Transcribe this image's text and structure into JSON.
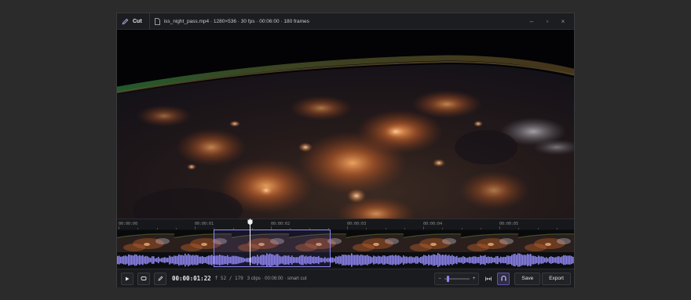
{
  "titlebar": {
    "app_name": "Cut",
    "file_info": "iss_night_pass.mp4 · 1280×536 · 30 fps · 00:06:00 · 180 frames",
    "minimize": "–",
    "maximize": "▫",
    "close": "×"
  },
  "timeline": {
    "ruler_labels": [
      "00:00:00",
      "00:00:01",
      "00:00:02",
      "00:00:03",
      "00:00:04",
      "00:00:05"
    ],
    "playhead_fraction": 0.29,
    "selection": {
      "start_fraction": 0.212,
      "end_fraction": 0.464
    },
    "waveform_color": "#8f86f0"
  },
  "controls": {
    "timecode": "00:00:01:22",
    "frame": "f 52 / 179",
    "status": "3 clips · 00:06:00 · smart cut",
    "zoom_minus": "−",
    "zoom_plus": "+",
    "zoom_level_fraction": 0.1,
    "save_label": "Save",
    "export_label": "Export"
  },
  "colors": {
    "accent": "#8f86f0",
    "background": "#2b2b2b",
    "window": "#111214"
  },
  "icons": {
    "app": "pen-icon",
    "file": "file-icon",
    "play": "play-icon",
    "loop": "loop-icon",
    "edit": "pen-icon",
    "fit": "fit-width-icon",
    "snap": "magnet-icon"
  }
}
